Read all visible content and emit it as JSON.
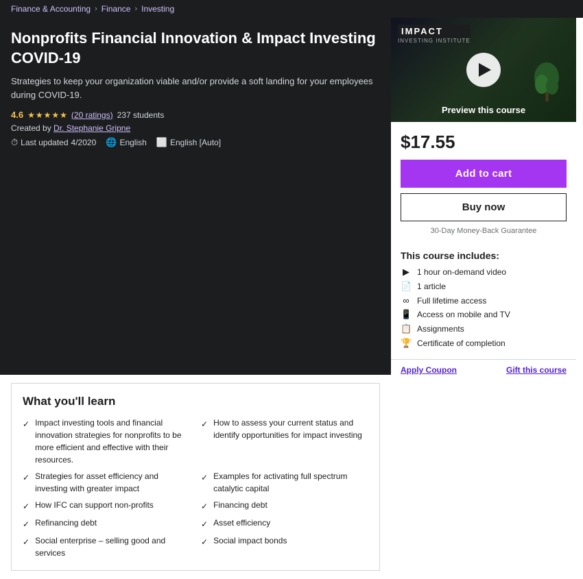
{
  "breadcrumb": {
    "items": [
      "Finance & Accounting",
      "Finance",
      "Investing"
    ]
  },
  "course": {
    "title": "Nonprofits Financial Innovation & Impact Investing COVID-19",
    "subtitle": "Strategies to keep your organization viable and/or provide a soft landing for your employees during COVID-19.",
    "rating": "4.6",
    "ratings_count": "(20 ratings)",
    "students": "237 students",
    "creator_label": "Created by",
    "creator_name": "Dr. Stephanie Gripne",
    "last_updated_label": "Last updated",
    "last_updated": "4/2020",
    "language": "English",
    "captions": "English [Auto]"
  },
  "sidebar": {
    "preview_label": "Preview this course",
    "price": "$17.55",
    "add_to_cart": "Add to cart",
    "buy_now": "Buy now",
    "guarantee": "30-Day Money-Back Guarantee",
    "includes_title": "This course includes:",
    "includes": [
      {
        "icon": "▶",
        "text": "1 hour on-demand video"
      },
      {
        "icon": "📄",
        "text": "1 article"
      },
      {
        "icon": "∞",
        "text": "Full lifetime access"
      },
      {
        "icon": "📱",
        "text": "Access on mobile and TV"
      },
      {
        "icon": "📋",
        "text": "Assignments"
      },
      {
        "icon": "🏆",
        "text": "Certificate of completion"
      }
    ],
    "apply_coupon": "Apply Coupon",
    "gift_course": "Gift this course"
  },
  "learn_section": {
    "title": "What you'll learn",
    "items": [
      "Impact investing tools and financial innovation strategies for nonprofits to be more efficient and effective with their resources.",
      "Strategies for asset efficiency and investing with greater impact",
      "How IFC can support non-profits",
      "Refinancing debt",
      "Social enterprise – selling good and services",
      "How to assess your current status and identify opportunities for impact investing",
      "Examples for activating full spectrum catalytic capital",
      "Financing debt",
      "Asset efficiency",
      "Social impact bonds"
    ]
  }
}
